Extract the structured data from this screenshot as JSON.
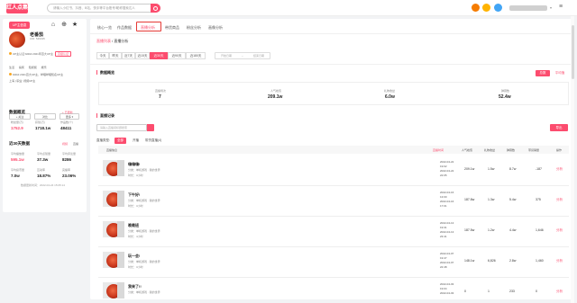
{
  "header": {
    "logo": "红人点集",
    "search_placeholder": "请输入小红书、抖音、B站、快手等平台账号/昵称搜索达人"
  },
  "profile": {
    "badge": "UP主信息",
    "name": "老番茄",
    "uid": "UID: 546195",
    "auth_text": "UP主认证:bilibili 2021年百大UP主",
    "auth_badge": "高级认证",
    "tags": [
      "生活",
      "搞笑",
      "短视频",
      "娱乐"
    ],
    "line1": "bilibili 2021百大UP主、哔哩哔哩知名UP主",
    "line2": "上海 | 职业: 视频UP主",
    "btn_follow": "+ 关注",
    "btn_compare": "对比",
    "btn_more": "更多 ▾"
  },
  "data_overview": {
    "title": "数据概览",
    "link": "+ 已更新",
    "items": [
      {
        "label": "粉丝量(万)",
        "value": "1752.9",
        "highlight": true
      },
      {
        "label": "获赞(万)",
        "value": "1718.1w",
        "highlight": false
      },
      {
        "label": "作品数(个)",
        "value": "48411",
        "highlight": false
      }
    ]
  },
  "recent30": {
    "title": "近30天数据",
    "link1": "视频",
    "link2": "直播",
    "items": [
      {
        "label": "平均播放量",
        "value": "595.1w",
        "highlight": true
      },
      {
        "label": "平均点赞量",
        "value": "37.3w",
        "highlight": false
      },
      {
        "label": "平均评论量",
        "value": "8286",
        "highlight": false
      },
      {
        "label": "平均投币量",
        "value": "7.0w",
        "highlight": false
      },
      {
        "label": "互动率",
        "value": "18.87%",
        "highlight": false
      },
      {
        "label": "完播率",
        "value": "23.06%",
        "highlight": false
      }
    ],
    "update_time": "数据更新时间：2022-04-24 15:05:14"
  },
  "tabs": [
    "核心一览",
    "作品数据",
    "直播分析",
    "带货商品",
    "粉丝分析",
    "画像分析"
  ],
  "active_tab": "直播分析",
  "breadcrumb": {
    "root": "直播列表",
    "sep": " / ",
    "current": "直播分析"
  },
  "date_segments": [
    "今天",
    "昨天",
    "近7天",
    "近15天",
    "近30天",
    "近90天",
    "近180天"
  ],
  "date_range": {
    "start": "开始日期",
    "sep": "~",
    "end": "结束日期"
  },
  "overview": {
    "title": "数据概览",
    "toggle_on": "总数",
    "toggle_off": "平均值",
    "metrics": [
      {
        "label": "直播场次",
        "value": "7"
      },
      {
        "label": "人气峰值",
        "value": "209.1w"
      },
      {
        "label": "礼物收益",
        "value": "6.0w"
      },
      {
        "label": "弹幕数",
        "value": "52.4w"
      }
    ]
  },
  "live_records": {
    "title": "直播记录",
    "search_placeholder": "请输入直播间标题搜索",
    "export": "导出",
    "filters": [
      "直播类型:",
      "全部",
      "开播",
      "带货直播(4)"
    ],
    "columns": [
      "直播信息",
      "直播时间",
      "人气峰值",
      "礼物收益",
      "弹幕数",
      "带货销量",
      "操作"
    ],
    "rows": [
      {
        "title": "嗨嗨嗨!",
        "sub": "分类：单机游戏 · 我的世界",
        "duration": "时长：3小时",
        "date": "2022-04-22\n19:02\n2022-04-22\n22:05",
        "peak": "209.1w",
        "gift": "1.5w",
        "danmu": "8.7w",
        "sales": "-187",
        "op": "分析"
      },
      {
        "title": "下午好!",
        "sub": "分类：单机游戏 · 我的世界",
        "duration": "时长：3小时",
        "date": "2022-04-16\n13:00\n2022-04-16\n17:01",
        "peak": "187.8w",
        "gift": "1.3w",
        "danmu": "5.4w",
        "sales": "375",
        "op": "分析"
      },
      {
        "title": "晚晚班",
        "sub": "分类：单机游戏 · 我的世界",
        "duration": "时长：4小时",
        "date": "2022-04-13\n19:31\n2022-04-13\n23:41",
        "peak": "187.5w",
        "gift": "1.2w",
        "danmu": "4.4w",
        "sales": "1,646",
        "op": "分析"
      },
      {
        "title": "玩一会!",
        "sub": "分类：单机游戏 · 我的世界",
        "duration": "时长：3小时",
        "date": "2022-04-07\n19:47\n2022-04-07\n22:48",
        "peak": "148.1w",
        "gift": "6,826",
        "danmu": "2.8w",
        "sales": "1,460",
        "op": "分析"
      },
      {
        "title": "我来了!!",
        "sub": "分类：单机游戏 · 我的世界",
        "duration": "时长：3小时",
        "date": "2022-04-03\n19:04\n2022-04-03",
        "peak": "0",
        "gift": "1",
        "danmu": "233",
        "sales": "0",
        "op": "分析"
      }
    ]
  },
  "colors": {
    "brand": "#fc4c6e",
    "highlight_box": "#e53935"
  },
  "icons": [
    "search-icon",
    "home-icon",
    "share-icon",
    "star-icon",
    "coin-icon",
    "bell-icon",
    "menu-icon",
    "export-icon"
  ]
}
